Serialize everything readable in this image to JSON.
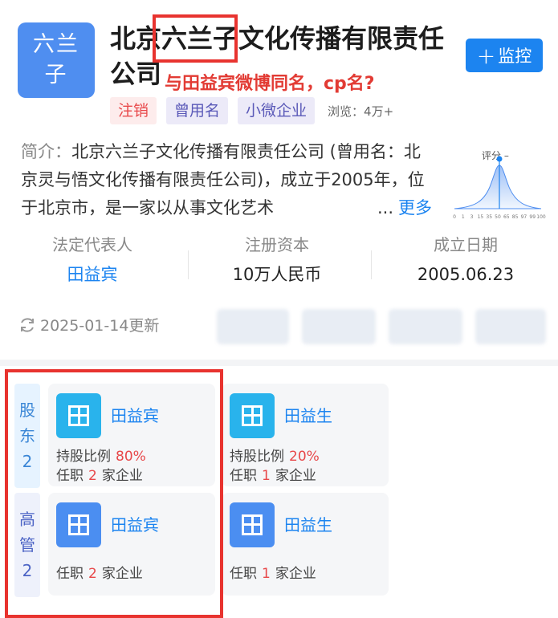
{
  "company": {
    "logo_line1": "六兰",
    "logo_line2": "子",
    "title_line1": "北京六兰子文化传播有限责任",
    "title_line2": "公司",
    "annotation": "与田益宾微博同名，cp名?",
    "monitor_label": "监控",
    "tags": [
      "注销",
      "曾用名",
      "小微企业"
    ],
    "views": "浏览：4万+"
  },
  "intro": {
    "label": "简介：",
    "text": "北京六兰子文化传播有限责任公司 (曾用名：北京灵与悟文化传播有限责任公司)，成立于2005年，位于北京市，是一家以从事文化艺术",
    "dots": "...",
    "more": "更多"
  },
  "score": {
    "title": "评分 –",
    "ticks": [
      "0",
      "1",
      "3",
      "15",
      "35",
      "50",
      "65",
      "85",
      "97",
      "99",
      "100"
    ]
  },
  "info": [
    {
      "label": "法定代表人",
      "value": "田益宾"
    },
    {
      "label": "注册资本",
      "value": "10万人民币"
    },
    {
      "label": "成立日期",
      "value": "2005.06.23"
    }
  ],
  "updated": "2025-01-14更新",
  "shareholders": {
    "tab_label": [
      "股",
      "东",
      "2"
    ],
    "people": [
      {
        "name": "田益宾",
        "ratio_label": "持股比例",
        "ratio": "80%",
        "job_prefix": "任职",
        "job_count": "2",
        "job_suffix": "家企业"
      },
      {
        "name": "田益生",
        "ratio_label": "持股比例",
        "ratio": "20%",
        "job_prefix": "任职",
        "job_count": "1",
        "job_suffix": "家企业"
      }
    ]
  },
  "executives": {
    "tab_label": [
      "高",
      "管",
      "2"
    ],
    "people": [
      {
        "name": "田益宾",
        "job_prefix": "任职",
        "job_count": "2",
        "job_suffix": "家企业"
      },
      {
        "name": "田益生",
        "job_prefix": "任职",
        "job_count": "1",
        "job_suffix": "家企业"
      }
    ]
  },
  "colors": {
    "accent": "#1c84f0",
    "annotation_red": "#e8332f",
    "logo_blue": "#4f8ef0"
  }
}
